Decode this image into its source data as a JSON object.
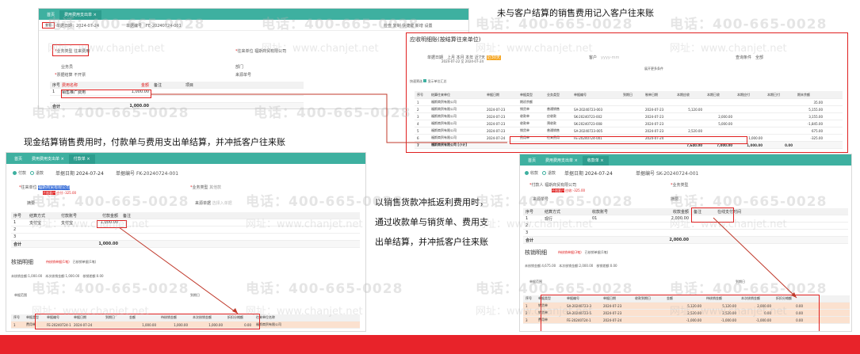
{
  "annotations": {
    "top_right": "未与客户结算的销售费用记入客户往来账",
    "left": "现金结算销售费用时，付款单与费用支出单结算，并冲抵客户往来账",
    "right_line1": "以销售货款冲抵返利费用时，",
    "right_line2": "通过收款单与销货单、费用支",
    "right_line3": "出单结算，并冲抵客户往来账"
  },
  "watermark": {
    "phone": "电话：400-665-0028",
    "site": "网址：www.chanjet.net"
  },
  "expense_window": {
    "tabs": [
      "首页",
      "费用费用支出单 ×"
    ],
    "toolbar": [
      "查看",
      "单据日期：2024-07-24",
      "单据编号",
      "FE-20240724-001",
      "检查",
      "复制",
      "快捷键",
      "新增",
      "设置"
    ],
    "doc_date_label": "单据日期",
    "doc_date": "2024-07-24",
    "doc_no_label": "单据编号",
    "doc_no": "FE-20240724-001",
    "business_type_label": "业务类型",
    "business_type": "往来费用",
    "partner_label": "往来单位",
    "partner": "福斯商贸有限公司",
    "salesman_label": "业务员",
    "dept_label": "部门",
    "settle_label": "票据结算",
    "settle": "不开票",
    "source_label": "来源单号",
    "grid_head": [
      "序号",
      "费用名称",
      "金额",
      "备注",
      "项目"
    ],
    "grid_rows": [
      [
        "1",
        "销售推广费用",
        "1,000.00"
      ]
    ],
    "total_label": "合计",
    "total": "1,000.00"
  },
  "ledger_window": {
    "title": "应收明细账(按结算往来单位)",
    "period_label": "单据日期",
    "periods": [
      "上月",
      "本月",
      "本年",
      "近7天",
      "近30天"
    ],
    "date_from": "2024-07-22",
    "date_to": "2024-07-24",
    "customer_label": "客户",
    "customer_ph": "yyyy-mm",
    "query_label": "查询条件",
    "query_val": "全部",
    "expand": "展开更多条件",
    "show_label": "快速筛选",
    "show_check": "显示单位汇总",
    "head": [
      "序号",
      "结算往来单位",
      "单据日期",
      "单据类型",
      "业务类型",
      "单据编号",
      "到期日",
      "制单日期",
      "本期应收",
      "本期已收",
      "本期应付",
      "本期已付",
      "期末余额"
    ],
    "rows": [
      [
        "1",
        "福斯商贸有限公司",
        "",
        "期初余额",
        "",
        "",
        "",
        "",
        "",
        "",
        "",
        "",
        "35.00"
      ],
      [
        "2",
        "福斯商贸有限公司",
        "2024-07-23",
        "销货单",
        "普通销售",
        "SA-20240723-003",
        "",
        "2024-07-23",
        "5,120.00",
        "",
        "",
        "",
        "5,155.00"
      ],
      [
        "3",
        "福斯商贸有限公司",
        "2024-07-23",
        "收款单",
        "应收款",
        "SK-20240723-002",
        "",
        "2024-07-23",
        "",
        "2,000.00",
        "",
        "",
        "3,155.00"
      ],
      [
        "4",
        "福斯商贸有限公司",
        "2024-07-23",
        "收款单",
        "预收款",
        "SK-20240723-008",
        "",
        "2024-07-23",
        "",
        "5,000.00",
        "",
        "",
        "-1,845.00"
      ],
      [
        "5",
        "福斯商贸有限公司",
        "2024-07-23",
        "销货单",
        "普通销售",
        "SA-20240723-005",
        "",
        "2024-07-23",
        "2,520.00",
        "",
        "",
        "",
        "675.00"
      ],
      [
        "6",
        "福斯商贸有限公司",
        "2024-07-24",
        "费用单",
        "往来费用",
        "FE-20240724-001",
        "",
        "2024-07-24",
        "",
        "",
        "1,000.00",
        "",
        "-325.00"
      ],
      [
        "7",
        "福斯商贸有限公司 [小计]",
        "",
        "",
        "",
        "",
        "",
        "",
        "7,640.00",
        "7,000.00",
        "1,000.00",
        "0.00",
        ""
      ]
    ]
  },
  "payment_window": {
    "tabs": [
      "首页",
      "费用费用支出单 ×",
      "付款单 ×"
    ],
    "radio_pay": "付款",
    "radio_refund": "退款",
    "doc_date_label": "单据日期",
    "doc_date": "2024-07-24",
    "doc_no_label": "单据编号",
    "doc_no": "FK-20240724-001",
    "partner_label": "往来单位",
    "partner": "福斯商贸有限公司",
    "business_label": "业务类型",
    "business": "其他款",
    "balance_tag": "不限客户",
    "balance": "应付:-325.00",
    "summary_label": "摘要",
    "source_label": "来源单据",
    "source_ph": "选择入单据",
    "grid_head": [
      "序号",
      "结算方式",
      "付款账号",
      "付款金额",
      "备注"
    ],
    "grid_rows": [
      [
        "1",
        "支付宝",
        "支付宝",
        "1,000.00"
      ],
      [
        "2",
        "",
        "",
        ""
      ],
      [
        "3",
        "",
        "",
        ""
      ]
    ],
    "total_label": "合计",
    "total": "1,000.00",
    "verify_title": "核销明细",
    "verify_tabs": [
      "待核销单据(1笔)",
      "已核销单据(1笔)"
    ],
    "verify_summary": [
      "未核销金额:1,000.00",
      "本次核销金额:1,000.00",
      "核销差额:0.00"
    ],
    "filter_label": "单据范围",
    "due_label": "到期日",
    "vhead": [
      "序号",
      "单据类型",
      "单据编号",
      "单据日期",
      "到期日",
      "金额",
      "待核销金额",
      "本次核销金额",
      "折扣分摊额",
      "往来单位名称"
    ],
    "vrows": [
      [
        "1",
        "费用单",
        "FE-20240724-1",
        "2024-07-24",
        "",
        "1,000.00",
        "1,000.00",
        "1,000.00",
        "0.00",
        "福斯商贸有限公司"
      ]
    ]
  },
  "receipt_window": {
    "tabs": [
      "首页",
      "费用费用支出单 ×",
      "收款单 ×"
    ],
    "radio_recv": "收款",
    "radio_refund": "退款",
    "doc_date_label": "单据日期",
    "doc_date": "2024-07-24",
    "doc_no_label": "单据编号",
    "doc_no": "SK-20240724-001",
    "partner_label": "付款人",
    "partner": "福斯商贸有限公司",
    "business_label": "业务类型",
    "balance_tag": "不限客户",
    "balance": "应收:-325.00",
    "source_label": "来源单号",
    "summary_label": "摘要",
    "grid_head": [
      "序号",
      "结算方式",
      "收款账号",
      "收款金额",
      "备注",
      "在线支付时间"
    ],
    "grid_rows": [
      [
        "1",
        "现行",
        "01",
        "2,000.00"
      ],
      [
        "2",
        "",
        "",
        ""
      ],
      [
        "3",
        "",
        "",
        ""
      ]
    ],
    "total_label": "合计",
    "total": "2,000.00",
    "verify_title": "核销明细",
    "verify_tabs": [
      "待核销单据(3笔)",
      "已核销单据(1笔)"
    ],
    "verify_summary": [
      "未核销金额:4,675.00",
      "本次核销金额:2,000.00",
      "核销差额:0.00"
    ],
    "filter_label": "单据范围",
    "due_label": "到期日",
    "vhead": [
      "序号",
      "单据类型",
      "单据编号",
      "单据日期",
      "收款到期日",
      "金额",
      "待核销金额",
      "本次核销金额",
      "折扣分摊额"
    ],
    "vrows": [
      [
        "1",
        "销货单",
        "SA-20240723-3",
        "2024-07-23",
        "",
        "5,120.00",
        "5,120.00",
        "2,000.00",
        "0.00"
      ],
      [
        "2",
        "销货单",
        "SA-20240723-5",
        "2024-07-23",
        "",
        "2,520.00",
        "2,520.00",
        "0.00",
        "0.00"
      ],
      [
        "3",
        "费用单",
        "FE-20240724-1",
        "2024-07-24",
        "",
        "-1,000.00",
        "-1,000.00",
        "-1,000.00",
        "0.00"
      ]
    ]
  }
}
